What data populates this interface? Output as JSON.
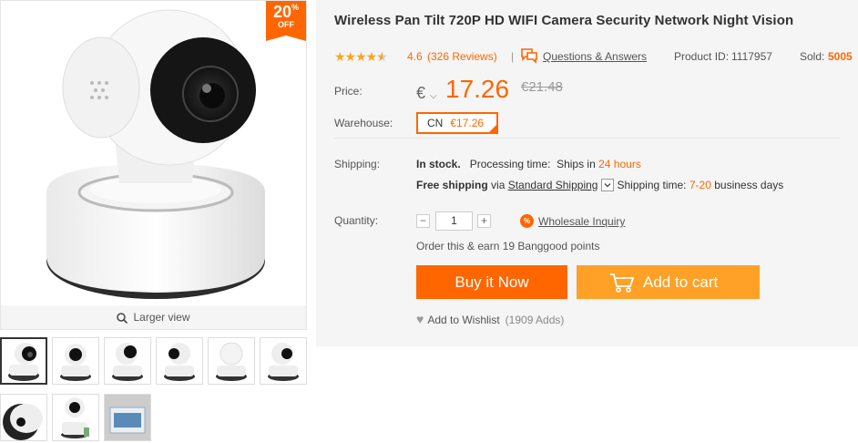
{
  "discount": {
    "percent": "20",
    "percent_sign": "%",
    "off": "OFF"
  },
  "gallery": {
    "larger_view": "Larger view",
    "thumbnail_count": 9
  },
  "product": {
    "title": "Wireless Pan Tilt 720P HD WIFI Camera Security Network Night Vision",
    "rating": "4.6",
    "rating_stars": 4.6,
    "reviews": "(326 Reviews)",
    "separator": "|",
    "qa_label": "Questions & Answers",
    "product_id_label": "Product ID:",
    "product_id": "1117957",
    "sold_label": "Sold:",
    "sold": "5005"
  },
  "price": {
    "label": "Price:",
    "currency": "€",
    "current": "17.26",
    "old": "€21.48"
  },
  "warehouse": {
    "label": "Warehouse:",
    "code": "CN",
    "price": "€17.26"
  },
  "shipping": {
    "label": "Shipping:",
    "stock": "In stock.",
    "processing_label": "Processing time:",
    "ships_in": "Ships in",
    "hours": "24 hours",
    "free": "Free shipping",
    "via": "via",
    "method": "Standard Shipping",
    "time_label": "Shipping time:",
    "days": "7-20",
    "days_suffix": "business days"
  },
  "quantity": {
    "label": "Quantity:",
    "value": "1",
    "minus": "−",
    "plus": "+",
    "wholesale_icon": "%",
    "wholesale": "Wholesale Inquiry"
  },
  "points": "Order this & earn 19 Banggood points",
  "buttons": {
    "buy": "Buy it Now",
    "cart": "Add to cart"
  },
  "wishlist": {
    "label": "Add to Wishlist",
    "adds": "(1909 Adds)"
  },
  "colors": {
    "accent": "#ff6600",
    "cart": "#ffa126",
    "star": "#f5a623",
    "panel": "#f5f5f5"
  }
}
